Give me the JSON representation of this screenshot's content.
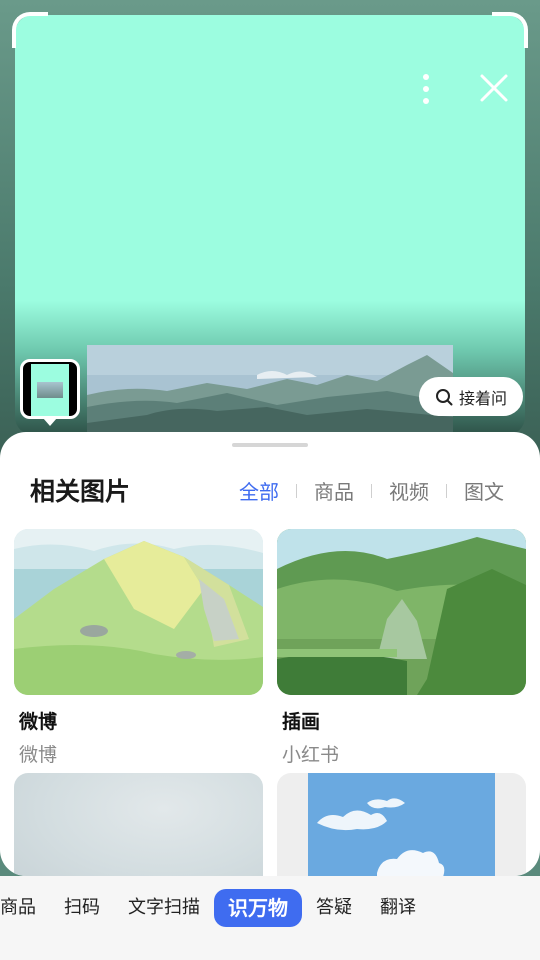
{
  "camera": {
    "ask_label": "接着问",
    "more_icon": "more-vertical-icon",
    "close_icon": "close-icon",
    "scan_bg_color": "#9cfde0"
  },
  "sheet": {
    "title": "相关图片",
    "filters": [
      {
        "label": "全部",
        "active": true
      },
      {
        "label": "商品",
        "active": false
      },
      {
        "label": "视频",
        "active": false
      },
      {
        "label": "图文",
        "active": false
      }
    ],
    "cards": [
      {
        "title": "微博",
        "source": "微博"
      },
      {
        "title": "插画",
        "source": "小红书"
      },
      {
        "title": "",
        "source": ""
      },
      {
        "title": "",
        "source": ""
      }
    ]
  },
  "tabbar": {
    "tabs": [
      {
        "label": "商品",
        "active": false
      },
      {
        "label": "扫码",
        "active": false
      },
      {
        "label": "文字扫描",
        "active": false
      },
      {
        "label": "识万物",
        "active": true
      },
      {
        "label": "答疑",
        "active": false
      },
      {
        "label": "翻译",
        "active": false
      }
    ],
    "accent_color": "#3f6cf0"
  }
}
